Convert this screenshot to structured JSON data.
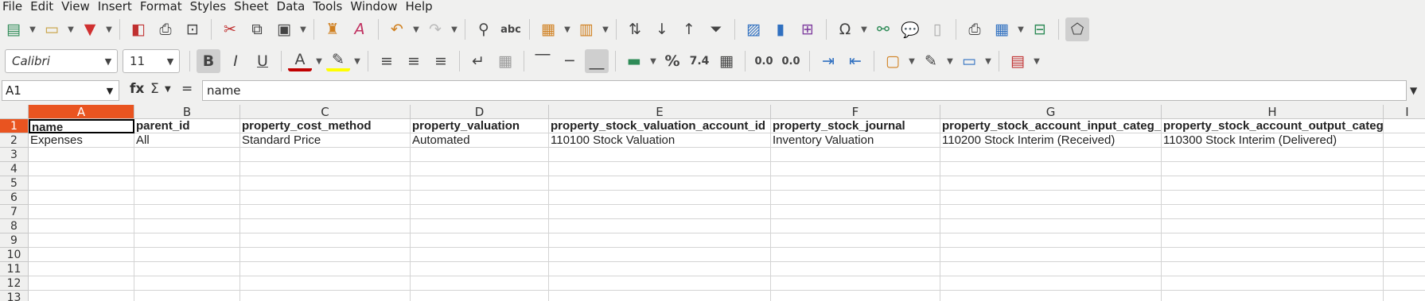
{
  "menu": [
    "File",
    "Edit",
    "View",
    "Insert",
    "Format",
    "Styles",
    "Sheet",
    "Data",
    "Tools",
    "Window",
    "Help"
  ],
  "font": {
    "name": "Calibri",
    "size": "11"
  },
  "name_box": "A1",
  "formula": "name",
  "formula_icons": {
    "fx": "fx",
    "sum": "Σ",
    "eq": "="
  },
  "columns": [
    "A",
    "B",
    "C",
    "D",
    "E",
    "F",
    "G",
    "H",
    "I"
  ],
  "rows": [
    "1",
    "2",
    "3",
    "4",
    "5",
    "6",
    "7",
    "8",
    "9",
    "10",
    "11",
    "12",
    "13"
  ],
  "cells": [
    [
      "name",
      "parent_id",
      "property_cost_method",
      "property_valuation",
      "property_stock_valuation_account_id",
      "property_stock_journal",
      "property_stock_account_input_categ_id",
      "property_stock_account_output_categ_id",
      ""
    ],
    [
      "Expenses",
      "All",
      "Standard Price",
      "Automated",
      "110100 Stock Valuation",
      "Inventory Valuation",
      "110200 Stock Interim (Received)",
      "110300 Stock Interim (Delivered)",
      ""
    ]
  ],
  "toolbar_icons": {
    "percent": "%",
    "number": "7.4",
    "dec_add": "0.0",
    "dec_del": "0.0"
  },
  "accent_color": "#e95420"
}
